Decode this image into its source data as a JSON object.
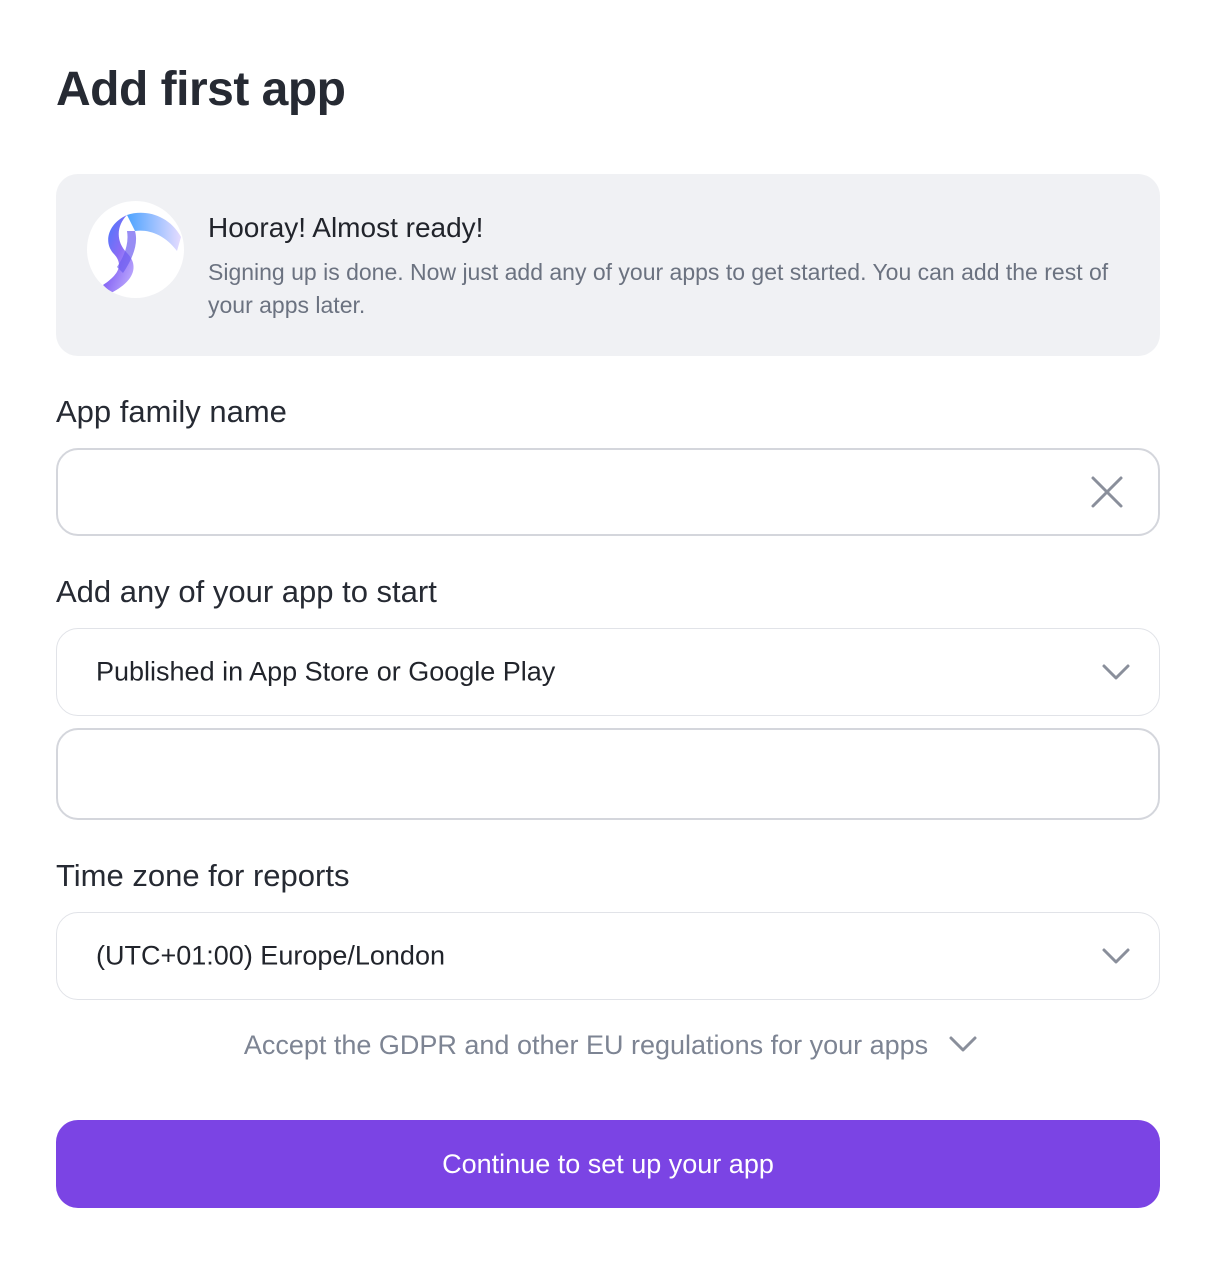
{
  "page": {
    "title": "Add first app"
  },
  "banner": {
    "title": "Hooray! Almost ready!",
    "text": "Signing up is done. Now just add any of your apps to get started. You can add the rest of your apps later.",
    "logo_icon": "ribbon-logo-icon"
  },
  "app_family": {
    "label": "App family name",
    "value": "",
    "placeholder": "",
    "clear_icon": "close-icon"
  },
  "app_source": {
    "label": "Add any of your app to start",
    "selected": "Published in App Store or Google Play",
    "link_value": "",
    "link_placeholder": ""
  },
  "timezone": {
    "label": "Time zone for reports",
    "selected": "(UTC+01:00) Europe/London"
  },
  "gdpr": {
    "text": "Accept the GDPR and other EU regulations for your apps"
  },
  "cta": {
    "label": "Continue to set up your app"
  },
  "colors": {
    "accent": "#7b44e4",
    "banner_bg": "#f0f1f4",
    "muted_text": "#6b7280",
    "border": "#d4d6dc"
  }
}
